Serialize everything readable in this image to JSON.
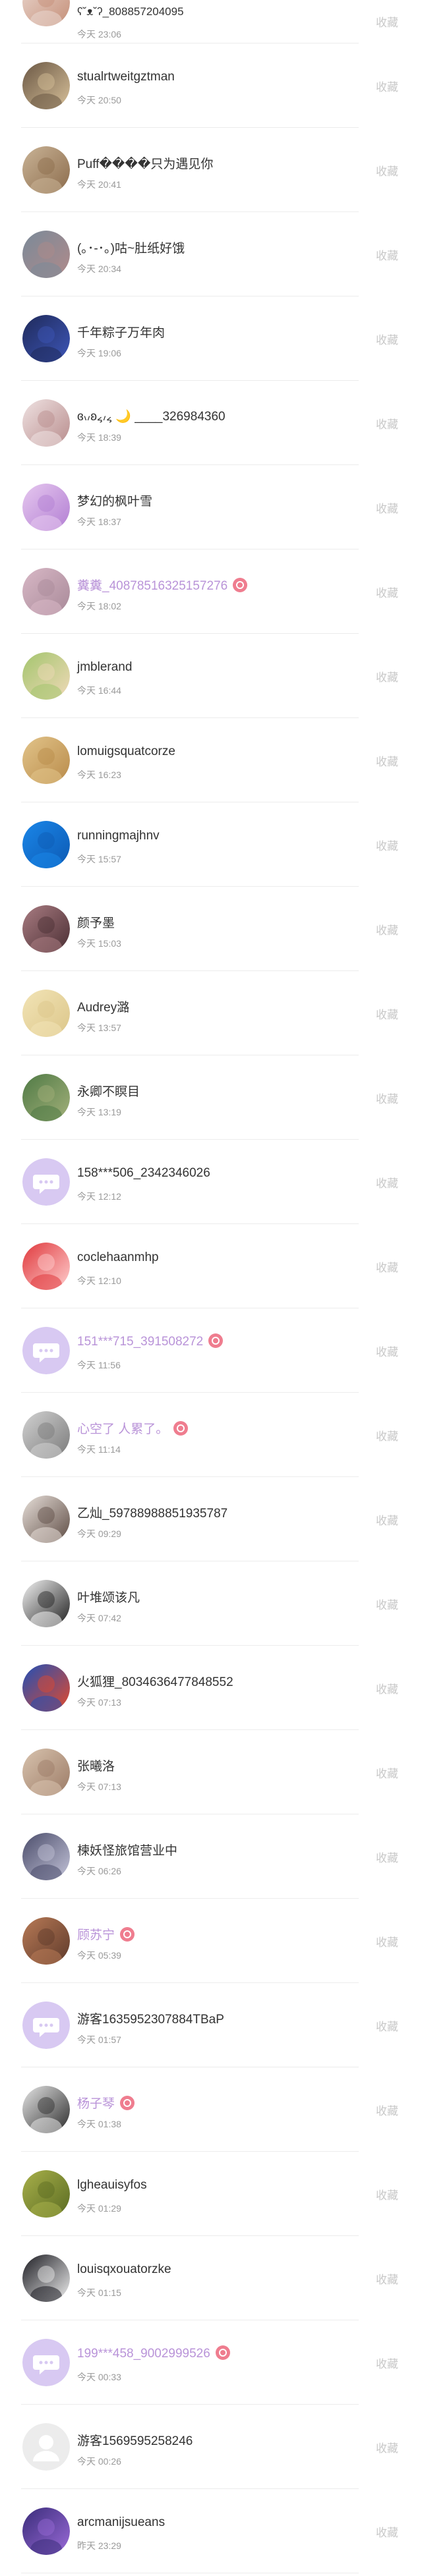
{
  "collect_label": "收藏",
  "items": [
    {
      "name": "ʕ˘ᴥ˘ʔ_808857204095",
      "time": "今天 23:06",
      "vip": false,
      "avatar": "cute-face-avatar",
      "colors": [
        "#ead7cf",
        "#c58f78"
      ]
    },
    {
      "name": "stualrtweitgztman",
      "time": "今天 20:50",
      "vip": false,
      "avatar": "dog-photo-avatar",
      "colors": [
        "#6a5744",
        "#d8c19a"
      ]
    },
    {
      "name": "Puff����只为遇见你",
      "time": "今天 20:41",
      "vip": false,
      "avatar": "cat-photo-avatar",
      "colors": [
        "#c9b396",
        "#8c6c4c"
      ]
    },
    {
      "name": "(｡･-･｡)咕~肚纸好饿",
      "time": "今天 20:34",
      "vip": false,
      "avatar": "landscape-avatar",
      "colors": [
        "#7a8a99",
        "#b08a8a"
      ]
    },
    {
      "name": "千年粽子万年肉",
      "time": "今天 19:06",
      "vip": false,
      "avatar": "anime-avatar",
      "colors": [
        "#1f2a5a",
        "#3d56b8"
      ]
    },
    {
      "name": "ɞ៶៸ʚ͏៹៸៹  🌙 ____326984360",
      "time": "今天 18:39",
      "vip": false,
      "avatar": "girl-photo-avatar",
      "colors": [
        "#efe2e2",
        "#b88c8c"
      ]
    },
    {
      "name": "梦幻的枫叶雪",
      "time": "今天 18:37",
      "vip": false,
      "avatar": "purple-anime-avatar",
      "colors": [
        "#e6c8ef",
        "#b27ed3"
      ]
    },
    {
      "name": "糞糞_4087851632515727​6",
      "time": "今天 18:02",
      "vip": true,
      "avatar": "girl-photo-avatar",
      "colors": [
        "#d8b8c6",
        "#a88998"
      ]
    },
    {
      "name": "jmblerand",
      "time": "今天 16:44",
      "vip": false,
      "avatar": "cartoon-avatar",
      "colors": [
        "#a3c56d",
        "#f0d9b8"
      ]
    },
    {
      "name": "lomuigsquatcorze",
      "time": "今天 16:23",
      "vip": false,
      "avatar": "golden-avatar",
      "colors": [
        "#e2c48a",
        "#b98b4a"
      ]
    },
    {
      "name": "runningmajhnv",
      "time": "今天 15:57",
      "vip": false,
      "avatar": "blue-avatar",
      "colors": [
        "#1a86e8",
        "#0d5ab4"
      ]
    },
    {
      "name": "颜予墨",
      "time": "今天 15:03",
      "vip": false,
      "avatar": "girl-photo-avatar",
      "colors": [
        "#a97c82",
        "#4a2e33"
      ]
    },
    {
      "name": "Audrey潞",
      "time": "今天 13:57",
      "vip": false,
      "avatar": "light-avatar",
      "colors": [
        "#f2e4b6",
        "#dcc68a"
      ]
    },
    {
      "name": "永卿不瞑目",
      "time": "今天 13:19",
      "vip": false,
      "avatar": "nature-avatar",
      "colors": [
        "#4f7a45",
        "#a3b07a"
      ]
    },
    {
      "name": "158***506_2342346026",
      "time": "今天 12:12",
      "vip": false,
      "avatar": "chat-bubble-avatar",
      "colors": [
        "#d8c9f2",
        "#ffffff"
      ]
    },
    {
      "name": "coclehaanmhp",
      "time": "今天 12:10",
      "vip": false,
      "avatar": "red-avatar",
      "colors": [
        "#e0383c",
        "#ffd0d0"
      ]
    },
    {
      "name": "151***715_391508272",
      "time": "今天 11:56",
      "vip": true,
      "avatar": "chat-bubble-avatar",
      "colors": [
        "#d8c9f2",
        "#ffffff"
      ]
    },
    {
      "name": "心空了 人累了。",
      "time": "今天 11:14",
      "vip": true,
      "avatar": "gray-avatar",
      "colors": [
        "#d2d2d2",
        "#7a7a7a"
      ]
    },
    {
      "name": "乙灿_59788988851935787",
      "time": "今天 09:29",
      "vip": false,
      "avatar": "dark-photo-avatar",
      "colors": [
        "#e7dfd9",
        "#5e4c44"
      ]
    },
    {
      "name": "叶堆颂该凡",
      "time": "今天 07:42",
      "vip": false,
      "avatar": "silhouette-avatar",
      "colors": [
        "#f4f4f4",
        "#1e1e1e"
      ]
    },
    {
      "name": "火狐狸_8034636477848552",
      "time": "今天 07:13",
      "vip": false,
      "avatar": "fox-avatar",
      "colors": [
        "#1f4fb7",
        "#e44a2b"
      ]
    },
    {
      "name": "张曦洛",
      "time": "今天 07:13",
      "vip": false,
      "avatar": "girl-photo-avatar",
      "colors": [
        "#d8c3ae",
        "#9c7b66"
      ]
    },
    {
      "name": "楝妖怪旅馆营业中",
      "time": "今天 06:26",
      "vip": false,
      "avatar": "dark-anime-avatar",
      "colors": [
        "#4b4d6b",
        "#c3c3d8"
      ]
    },
    {
      "name": "顾苏宁",
      "time": "今天 05:39",
      "vip": true,
      "avatar": "warm-avatar",
      "colors": [
        "#b87a56",
        "#5e3a2b"
      ]
    },
    {
      "name": "游客1635952307884TBaP",
      "time": "今天 01:57",
      "vip": false,
      "avatar": "chat-bubble-avatar",
      "colors": [
        "#d8c9f2",
        "#ffffff"
      ]
    },
    {
      "name": "杨子琴",
      "time": "今天 01:38",
      "vip": true,
      "avatar": "bw-avatar",
      "colors": [
        "#e5e5e5",
        "#2c2c2c"
      ]
    },
    {
      "name": "lgheauisyfos",
      "time": "今天 01:29",
      "vip": false,
      "avatar": "green-avatar",
      "colors": [
        "#a8b04a",
        "#5a6b22"
      ]
    },
    {
      "name": "louisqxouatorzke",
      "time": "今天 01:15",
      "vip": false,
      "avatar": "black-avatar",
      "colors": [
        "#1c1c22",
        "#f0f0f0"
      ]
    },
    {
      "name": "199***458_9002999526",
      "time": "今天 00:33",
      "vip": true,
      "avatar": "chat-bubble-avatar",
      "colors": [
        "#d8c9f2",
        "#ffffff"
      ]
    },
    {
      "name": "游客1569595258246",
      "time": "今天 00:26",
      "vip": false,
      "avatar": "default-user-avatar",
      "colors": [
        "#ececec",
        "#ffffff"
      ]
    },
    {
      "name": "arcmanijsueans",
      "time": "昨天 23:29",
      "vip": false,
      "avatar": "purple-avatar",
      "colors": [
        "#3a2d7a",
        "#9a6ad8"
      ]
    }
  ]
}
